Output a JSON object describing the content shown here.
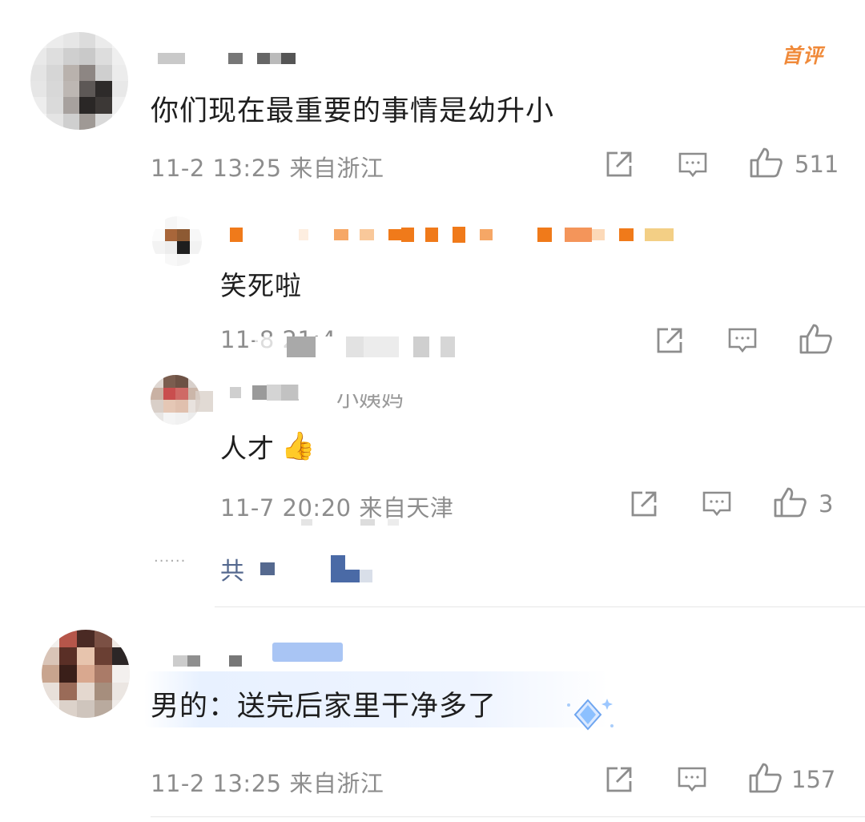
{
  "comment1": {
    "badge": "首评",
    "text": "你们现在最重要的事情是幼升小",
    "meta": "11-2 13:25 来自浙江",
    "likes": "511"
  },
  "reply1": {
    "text": "笑死啦",
    "meta": "11-8 21:4"
  },
  "reply2": {
    "name_visible": "小姨妈",
    "text": "人才",
    "emoji": "👍",
    "meta": "11-7 20:20 来自天津",
    "likes": "3"
  },
  "more_replies": {
    "dots": "······",
    "label": "共"
  },
  "comment2": {
    "text": "男的：送完后家里干净多了",
    "meta": "11-2 13:25 来自浙江",
    "likes": "157"
  },
  "colors": {
    "meta_gray": "#8d8d8d",
    "badge_orange": "#f08a3a",
    "blur_orange": "#f07a1a",
    "highlight_blue": "#e8f1ff"
  },
  "icons": [
    "share-icon",
    "comment-icon",
    "like-icon"
  ]
}
